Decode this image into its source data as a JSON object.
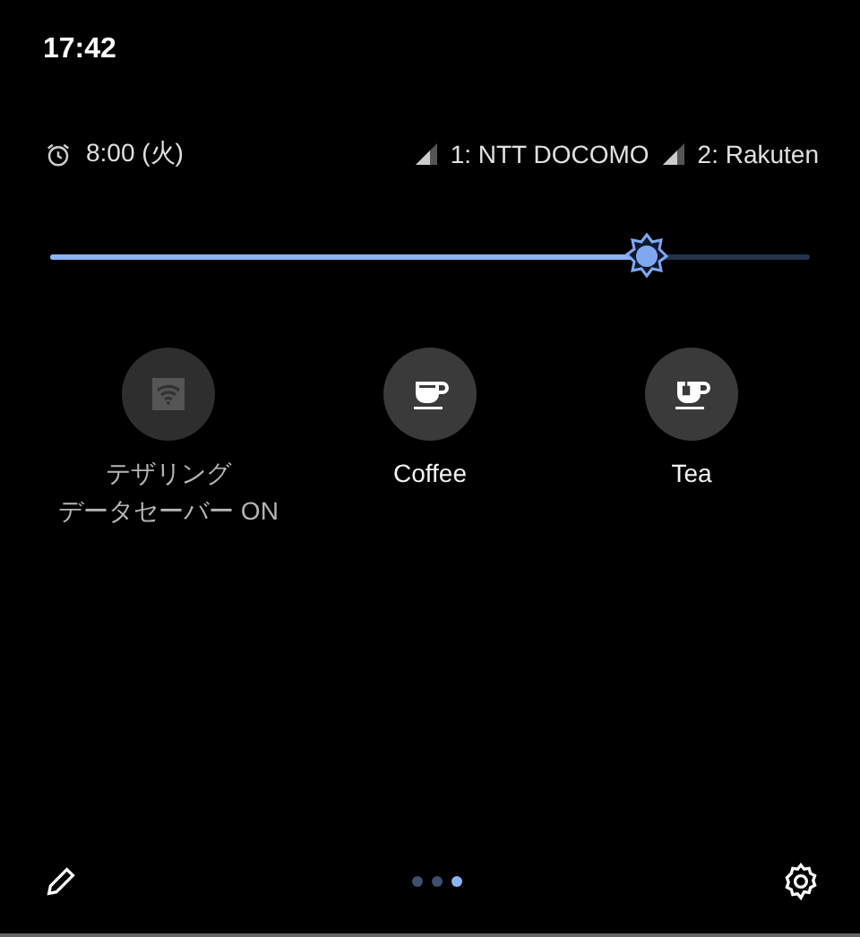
{
  "status_bar": {
    "time": "17:42"
  },
  "header": {
    "alarm": "8:00 (火)",
    "networks": [
      {
        "label": "1: NTT DOCOMO"
      },
      {
        "label": "2: Rakuten"
      }
    ]
  },
  "brightness": {
    "level": 0.785
  },
  "tiles": [
    {
      "kind": "wifi",
      "label": "テザリング",
      "secondary_label": "データセーバー ON",
      "disabled": true
    },
    {
      "kind": "coffee",
      "label": "Coffee",
      "disabled": false
    },
    {
      "kind": "tea",
      "label": "Tea",
      "disabled": false
    }
  ],
  "page_dots": [
    {
      "selected": false
    },
    {
      "selected": false
    },
    {
      "selected": true
    }
  ]
}
